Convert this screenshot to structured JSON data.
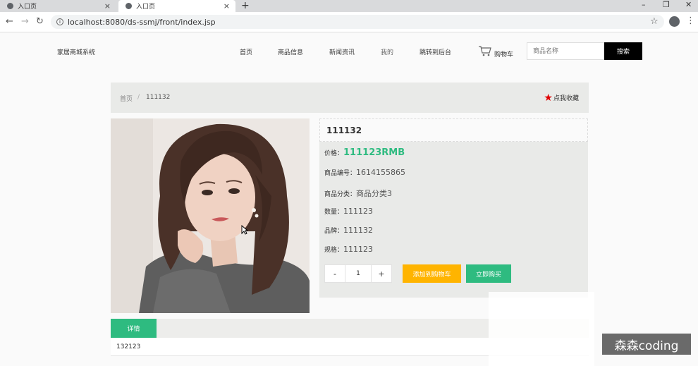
{
  "browser": {
    "tabs": [
      {
        "title": "入口页"
      },
      {
        "title": "入口页"
      }
    ],
    "url": "localhost:8080/ds-ssmj/front/index.jsp"
  },
  "header": {
    "brand": "家居商城系统",
    "nav": [
      "首页",
      "商品信息",
      "新闻资讯",
      "我的",
      "跳转到后台"
    ],
    "cart_label": "购物车",
    "search": {
      "placeholder": "商品名称",
      "button": "搜索"
    }
  },
  "breadcrumb": {
    "home": "首页",
    "separator": "/",
    "current": "111132",
    "favorite": "点我收藏"
  },
  "product": {
    "name": "111132",
    "price_label": "价格：",
    "price": "111123RMB",
    "code_label": "商品编号：",
    "code": "1614155865",
    "category_label": "商品分类：",
    "category": "商品分类3",
    "quantity_label": "数量：",
    "quantity": "111123",
    "brand_label": "品牌：",
    "brand": "111132",
    "spec_label": "规格：",
    "spec": "111123",
    "stepper": {
      "minus": "-",
      "value": "1",
      "plus": "+"
    },
    "add_to_cart": "添加到购物车",
    "buy_now": "立即购买"
  },
  "details": {
    "tab": "详情",
    "content": "132123"
  },
  "watermark": "森森coding",
  "colors": {
    "accent": "#2ebb80",
    "cart_button": "#ffb400",
    "favorite_star": "#e00000"
  }
}
